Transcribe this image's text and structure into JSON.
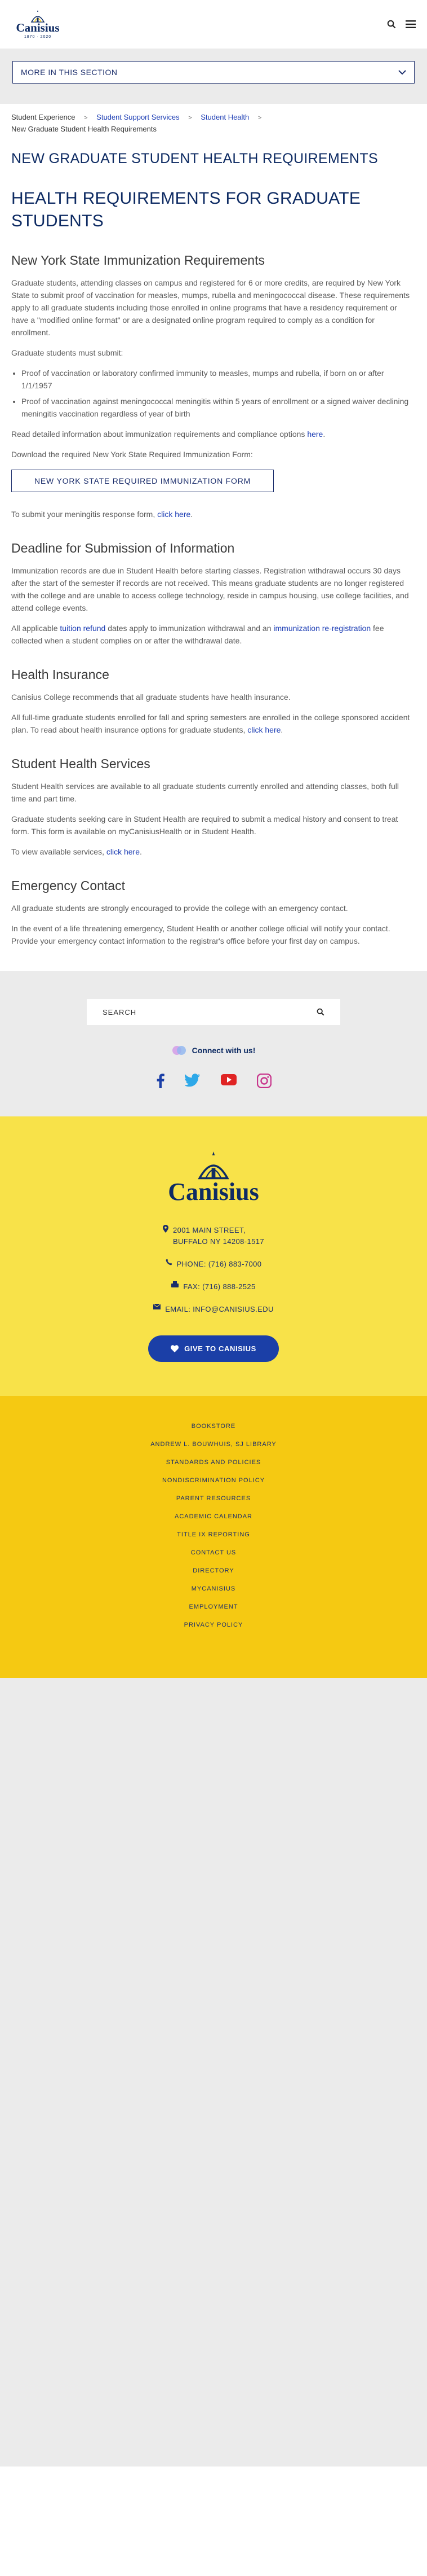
{
  "header": {
    "logo_text": "Canisius",
    "logo_years": "1870 · 2020",
    "search_icon": "search-icon",
    "menu_icon": "hamburger-menu-icon"
  },
  "section_nav": {
    "label": "MORE IN THIS SECTION"
  },
  "breadcrumb": {
    "items": [
      "Student Experience",
      "Student Support Services",
      "Student Health"
    ],
    "current": "New Graduate Student Health Requirements"
  },
  "main": {
    "page_title": "NEW GRADUATE STUDENT HEALTH REQUIREMENTS",
    "subtitle": "HEALTH REQUIREMENTS FOR GRADUATE STUDENTS",
    "immunization": {
      "heading": "New York State Immunization Requirements",
      "p1": "Graduate students, attending classes on campus and registered for 6 or more credits, are required by New York State to submit proof of vaccination for measles, mumps, rubella and meningococcal disease. These requirements apply to all graduate students including those enrolled in online programs that have a residency requirement or have a \"modified online format\" or are a designated online program required to comply as a condition for enrollment.",
      "p2": "Graduate students must submit:",
      "list": [
        "Proof of vaccination or laboratory confirmed immunity to measles, mumps and rubella, if born on or after 1/1/1957",
        "Proof of vaccination against meningococcal meningitis within 5 years of enrollment or a signed waiver declining meningitis vaccination regardless of year of birth"
      ],
      "p3_text": "Read detailed information about immunization requirements and compliance options ",
      "p3_link": "here",
      "p4": "Download the required New York State Required Immunization Form:",
      "form_button": "NEW YORK STATE REQUIRED IMMUNIZATION FORM",
      "p5_text": "To submit your meningitis response form, ",
      "p5_link": "click here"
    },
    "deadline": {
      "heading": "Deadline for Submission of Information",
      "p1": "Immunization records are due in Student Health before starting classes. Registration withdrawal occurs 30 days after the start of the semester if records are not received. This means graduate students are no longer registered with the college and are unable to access college technology, reside in campus housing, use college facilities, and attend college events.",
      "p2_a": "All applicable ",
      "p2_link1": "tuition refund",
      "p2_b": " dates apply to immunization withdrawal and an ",
      "p2_link2": "immunization re-registration",
      "p2_c": " fee collected when a student complies on or after the withdrawal date."
    },
    "insurance": {
      "heading": "Health Insurance",
      "p1": "Canisius College recommends that all graduate students have health insurance.",
      "p2_text": "All full-time graduate students enrolled for fall and spring semesters are enrolled in the college sponsored accident plan. To read about health insurance options for graduate students, ",
      "p2_link": "click here"
    },
    "services": {
      "heading": "Student Health Services",
      "p1": "Student Health services are available to all graduate students currently enrolled and attending classes, both full time and part time.",
      "p2": "Graduate students seeking care in Student Health are required to submit a medical history and consent to treat form. This form is available on myCanisiusHealth or in Student Health.",
      "p3_text": "To view available services, ",
      "p3_link": "click here"
    },
    "emergency": {
      "heading": "Emergency Contact",
      "p1": "All graduate students are strongly encouraged to provide the college with an emergency contact.",
      "p2": "In the event of a life threatening emergency, Student Health or another college official will notify your contact.  Provide your emergency contact information to the registrar's office before your first day on campus."
    }
  },
  "search": {
    "placeholder": "SEARCH"
  },
  "connect": {
    "label": "Connect with us!"
  },
  "social": [
    "facebook-icon",
    "twitter-icon",
    "youtube-icon",
    "instagram-icon"
  ],
  "footer": {
    "logo_text": "Canisius",
    "address_line1": "2001 MAIN STREET,",
    "address_line2": "BUFFALO NY 14208-1517",
    "phone": "PHONE: (716) 883-7000",
    "fax": "FAX: (716) 888-2525",
    "email": "EMAIL: INFO@CANISIUS.EDU",
    "give_button": "GIVE TO CANISIUS",
    "links": [
      "BOOKSTORE",
      "ANDREW L. BOUWHUIS, SJ LIBRARY",
      "STANDARDS AND POLICIES",
      "NONDISCRIMINATION POLICY",
      "PARENT RESOURCES",
      "ACADEMIC CALENDAR",
      "TITLE IX REPORTING",
      "CONTACT US",
      "DIRECTORY",
      "MYCANISIUS",
      "EMPLOYMENT",
      "PRIVACY POLICY"
    ]
  },
  "colors": {
    "navy": "#0e2b63",
    "link_blue": "#1a3bb3",
    "footer_yellow": "#f8e249",
    "footer_gold": "#f5c912",
    "give_blue": "#1b3fa7"
  }
}
